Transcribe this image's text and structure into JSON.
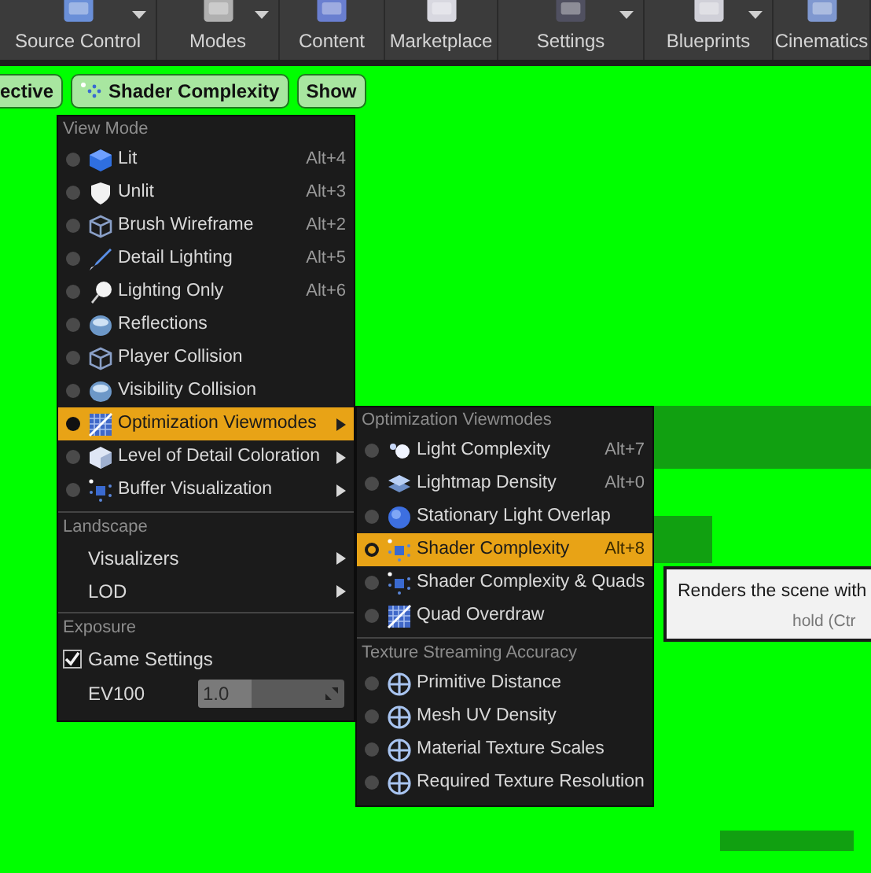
{
  "toolbar": [
    {
      "label": "Source Control",
      "dropdown": true
    },
    {
      "label": "Modes",
      "dropdown": true
    },
    {
      "label": "Content",
      "dropdown": false
    },
    {
      "label": "Marketplace",
      "dropdown": false
    },
    {
      "label": "Settings",
      "dropdown": true
    },
    {
      "label": "Blueprints",
      "dropdown": true
    },
    {
      "label": "Cinematics",
      "dropdown": false
    }
  ],
  "viewport_buttons": [
    {
      "label": "ective"
    },
    {
      "label": "Shader Complexity"
    },
    {
      "label": "Show"
    }
  ],
  "view_mode_menu": {
    "sections": [
      {
        "header": "View Mode",
        "items": [
          {
            "kind": "radio",
            "label": "Lit",
            "shortcut": "Alt+4",
            "selected": false
          },
          {
            "kind": "radio",
            "label": "Unlit",
            "shortcut": "Alt+3",
            "selected": false
          },
          {
            "kind": "radio",
            "label": "Brush Wireframe",
            "shortcut": "Alt+2",
            "selected": false
          },
          {
            "kind": "radio",
            "label": "Detail Lighting",
            "shortcut": "Alt+5",
            "selected": false
          },
          {
            "kind": "radio",
            "label": "Lighting Only",
            "shortcut": "Alt+6",
            "selected": false
          },
          {
            "kind": "radio",
            "label": "Reflections",
            "selected": false
          },
          {
            "kind": "radio",
            "label": "Player Collision",
            "selected": false
          },
          {
            "kind": "radio",
            "label": "Visibility Collision",
            "selected": false
          },
          {
            "kind": "radio",
            "label": "Optimization Viewmodes",
            "selected": true,
            "submenu": true
          },
          {
            "kind": "radio",
            "label": "Level of Detail Coloration",
            "selected": false,
            "submenu": true
          },
          {
            "kind": "radio",
            "label": "Buffer Visualization",
            "selected": false,
            "submenu": true
          }
        ]
      },
      {
        "header": "Landscape",
        "items": [
          {
            "kind": "plain",
            "label": "Visualizers",
            "submenu": true
          },
          {
            "kind": "plain",
            "label": "LOD",
            "submenu": true
          }
        ]
      },
      {
        "header": "Exposure",
        "items": [
          {
            "kind": "checkbox",
            "label": "Game Settings",
            "checked": true
          },
          {
            "kind": "spin",
            "label": "EV100",
            "value": "1.0",
            "level": 0.37
          }
        ]
      }
    ]
  },
  "optimization_submenu": {
    "sections": [
      {
        "header": "Optimization Viewmodes",
        "items": [
          {
            "kind": "radio",
            "label": "Light Complexity",
            "shortcut": "Alt+7",
            "selected": false
          },
          {
            "kind": "radio",
            "label": "Lightmap Density",
            "shortcut": "Alt+0",
            "selected": false
          },
          {
            "kind": "radio",
            "label": "Stationary Light Overlap",
            "selected": false
          },
          {
            "kind": "radio",
            "label": "Shader Complexity",
            "shortcut": "Alt+8",
            "selected": true
          },
          {
            "kind": "radio",
            "label": "Shader Complexity & Quads",
            "selected": false
          },
          {
            "kind": "radio",
            "label": "Quad Overdraw",
            "selected": false
          }
        ]
      },
      {
        "header": "Texture Streaming Accuracy",
        "items": [
          {
            "kind": "radio",
            "label": "Primitive Distance",
            "selected": false
          },
          {
            "kind": "radio",
            "label": "Mesh UV Density",
            "selected": false
          },
          {
            "kind": "radio",
            "label": "Material Texture Scales",
            "selected": false
          },
          {
            "kind": "radio",
            "label": "Required Texture Resolution",
            "selected": false
          }
        ]
      }
    ]
  },
  "tooltip": {
    "text": "Renders the scene with",
    "hint": "hold (Ctr"
  }
}
